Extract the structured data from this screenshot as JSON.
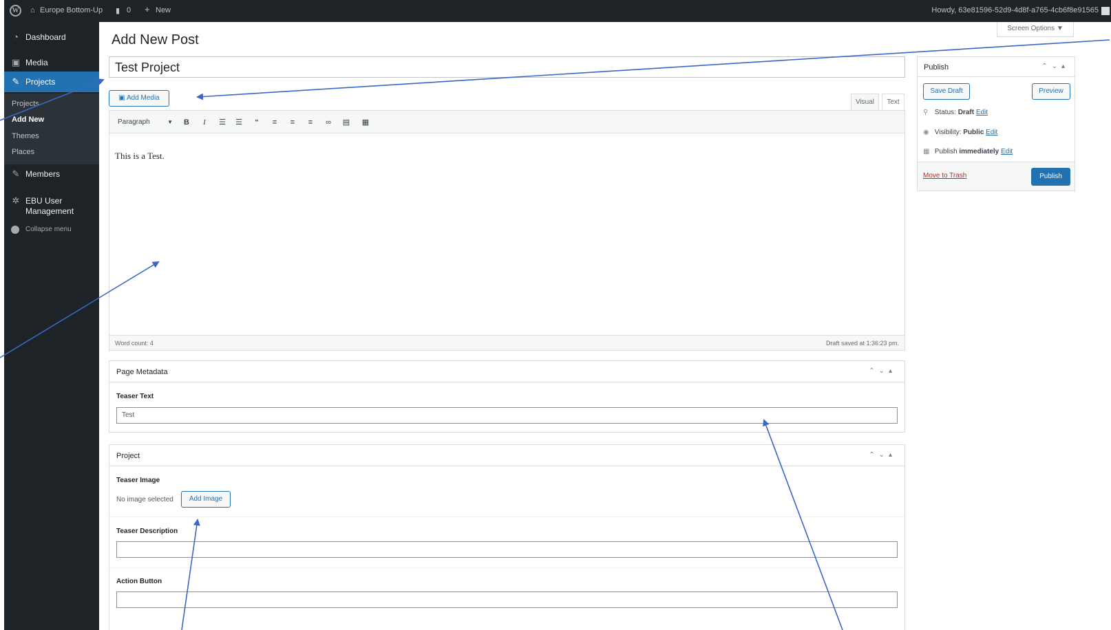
{
  "admin_bar": {
    "site_name": "Europe Bottom-Up",
    "comments_count": "0",
    "new_label": "New",
    "howdy": "Howdy, 63e81596-52d9-4d8f-a765-4cb6f8e91565"
  },
  "sidebar": {
    "items": [
      {
        "label": "Dashboard",
        "icon": "dashboard-icon"
      },
      {
        "label": "Media",
        "icon": "media-icon"
      },
      {
        "label": "Projects",
        "icon": "pin-icon"
      },
      {
        "label": "Members",
        "icon": "pin-icon"
      },
      {
        "label": "EBU User Management",
        "icon": "gear-icon"
      }
    ],
    "submenu": [
      "Projects",
      "Add New",
      "Themes",
      "Places"
    ],
    "collapse": "Collapse menu"
  },
  "page": {
    "title": "Add New Post",
    "screen_options": "Screen Options ▼",
    "post_title": "Test Project",
    "add_media": "Add Media"
  },
  "editor": {
    "tab_visual": "Visual",
    "tab_text": "Text",
    "format_select": "Paragraph",
    "content": "This is a Test.",
    "word_count": "Word count: 4",
    "draft_saved": "Draft saved at 1:36:23 pm."
  },
  "page_metadata": {
    "heading": "Page Metadata",
    "teaser_text_label": "Teaser Text",
    "teaser_text_value": "Test"
  },
  "project_box": {
    "heading": "Project",
    "teaser_image_label": "Teaser Image",
    "no_image": "No image selected",
    "add_image": "Add Image",
    "teaser_description_label": "Teaser Description",
    "action_button_label": "Action Button"
  },
  "publish": {
    "heading": "Publish",
    "save_draft": "Save Draft",
    "preview": "Preview",
    "status_label": "Status:",
    "status_value": "Draft",
    "visibility_label": "Visibility:",
    "visibility_value": "Public",
    "publish_when": "Publish",
    "publish_when_value": "immediately",
    "edit": "Edit",
    "move_to_trash": "Move to Trash",
    "publish_button": "Publish"
  },
  "colors": {
    "admin_dark": "#1d2327",
    "accent_blue": "#2271b1",
    "trash_red": "#b32d2e",
    "arrow_blue": "#3a66c4"
  }
}
